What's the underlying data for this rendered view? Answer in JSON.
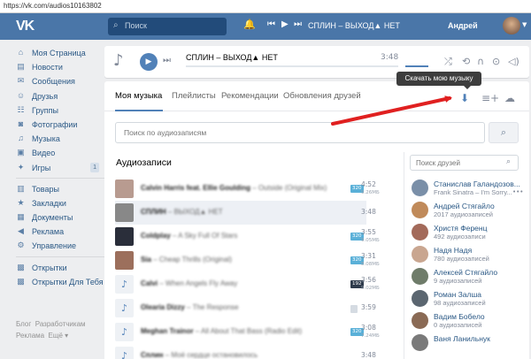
{
  "browser": {
    "url": "https://vk.com/audios10163802"
  },
  "topbar": {
    "logo": "VK",
    "search_placeholder": "Поиск",
    "track": "СПЛИН – ВЫХОД▲ НЕТ",
    "user_name": "Андрей"
  },
  "sidebar": {
    "items": [
      {
        "label": "Моя Страница",
        "icon": "home-icon"
      },
      {
        "label": "Новости",
        "icon": "news-icon"
      },
      {
        "label": "Сообщения",
        "icon": "messages-icon"
      },
      {
        "label": "Друзья",
        "icon": "friends-icon"
      },
      {
        "label": "Группы",
        "icon": "groups-icon"
      },
      {
        "label": "Фотографии",
        "icon": "photos-icon"
      },
      {
        "label": "Музыка",
        "icon": "music-icon"
      },
      {
        "label": "Видео",
        "icon": "video-icon"
      },
      {
        "label": "Игры",
        "icon": "games-icon",
        "badge": "1"
      }
    ],
    "items2": [
      {
        "label": "Товары"
      },
      {
        "label": "Закладки"
      },
      {
        "label": "Документы"
      },
      {
        "label": "Реклама"
      },
      {
        "label": "Управление"
      }
    ],
    "items3": [
      {
        "label": "Открытки"
      },
      {
        "label": "Открытки Для Тебя"
      }
    ],
    "footer": {
      "blog": "Блог",
      "devs": "Разработчикам",
      "ads": "Реклама",
      "more": "Ещё"
    }
  },
  "player": {
    "track": "СПЛИН – ВЫХОД▲ НЕТ",
    "time": "3:48",
    "progress": 0.0
  },
  "tabs": {
    "my_music": "Моя музыка",
    "playlists": "Плейлисты",
    "recommendations": "Рекомендации",
    "friends_updates": "Обновления друзей",
    "tooltip": "Скачать мою музыку"
  },
  "audio_search": {
    "placeholder": "Поиск по аудиозаписям"
  },
  "audios": {
    "title": "Аудиозаписи",
    "tracks": [
      {
        "artist": "Calvin Harris feat. Ellie Goulding",
        "song": "– Outside (Original Mix)",
        "time": "4:52",
        "size": "9.26МБ",
        "quality": "320"
      },
      {
        "artist": "СПЛИН",
        "song": "– ВЫХОД▲ НЕТ",
        "time": "3:48",
        "size": "",
        "quality": ""
      },
      {
        "artist": "Coldplay",
        "song": "– A Sky Full Of Stars",
        "time": "3:55",
        "size": "9.05МБ",
        "quality": "320"
      },
      {
        "artist": "Sia",
        "song": "– Cheap Thrills (Original)",
        "time": "3:31",
        "size": "8.08МБ",
        "quality": "320"
      },
      {
        "artist": "Calvi",
        "song": "– When Angels Fly Away",
        "time": "3:56",
        "size": "9.02МБ",
        "quality": "192"
      },
      {
        "artist": "Olearia Dizzy",
        "song": "– The Response",
        "time": "3:59",
        "size": "",
        "quality": ""
      },
      {
        "artist": "Meghan Trainor",
        "song": "– All About That Bass (Radio Edit)",
        "time": "3:08",
        "size": "7.24МБ",
        "quality": "320"
      },
      {
        "artist": "Сплин",
        "song": "– Моё сердце остановилось",
        "time": "3:48",
        "size": "",
        "quality": ""
      }
    ]
  },
  "friends": {
    "search_placeholder": "Поиск друзей",
    "list": [
      {
        "name": "Станислав Галандозов...",
        "sub": "Frank Sinatra – I'm Sorry...",
        "color": "#7a8fa8"
      },
      {
        "name": "Андрей Стягайло",
        "sub": "2017 аудиозаписей",
        "color": "#c08a5a"
      },
      {
        "name": "Христя Ференц",
        "sub": "492 аудиозаписи",
        "color": "#a36a5a"
      },
      {
        "name": "Надя Надя",
        "sub": "780 аудиозаписей",
        "color": "#c9a690"
      },
      {
        "name": "Алексей Стягайло",
        "sub": "9 аудиозаписей",
        "color": "#6f7c6a"
      },
      {
        "name": "Роман Залша",
        "sub": "98 аудиозаписей",
        "color": "#5b6670"
      },
      {
        "name": "Вадим Бобело",
        "sub": "0 аудиозаписей",
        "color": "#8a6a55"
      },
      {
        "name": "Ваня Ланильнук",
        "sub": "",
        "color": "#7a7a7a"
      }
    ]
  }
}
